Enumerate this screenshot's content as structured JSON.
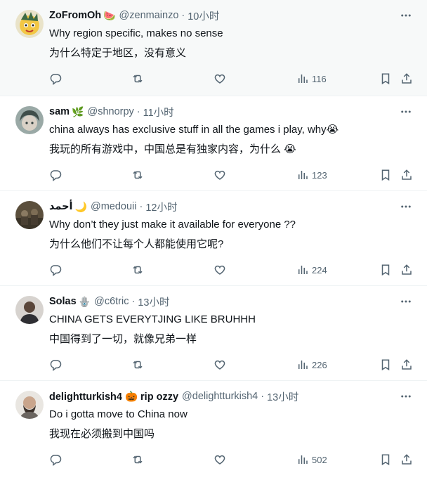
{
  "posts": [
    {
      "name": "ZoFromOh",
      "emoji": "🍉",
      "handle": "@zenmainzo",
      "time": "10小时",
      "text": "Why region specific, makes no sense",
      "translation": "为什么特定于地区，没有意义",
      "views": "116",
      "avatar_color": "#f2c744"
    },
    {
      "name": "sam",
      "emoji": "🌿",
      "handle": "@shnorpy",
      "time": "11小时",
      "text": "china always has exclusive stuff in all the games i play, why😭",
      "translation": "我玩的所有游戏中，中国总是有独家内容，为什么 😭",
      "views": "123",
      "avatar_color": "#7f9a9c"
    },
    {
      "name": "أحمد",
      "emoji": "🌙",
      "handle": "@medouii",
      "time": "12小时",
      "text": "Why don’t they just make it available for everyone ??",
      "translation": "为什么他们不让每个人都能使用它呢?",
      "views": "224",
      "avatar_color": "#5b4f3c"
    },
    {
      "name": "Solas",
      "emoji": "🪬",
      "handle": "@c6tric",
      "time": "13小时",
      "text": "CHINA GETS EVERYTJING LIKE BRUHHH",
      "translation": "中国得到了一切，就像兄弟一样",
      "views": "226",
      "avatar_color": "#6d6a66"
    },
    {
      "name": "delightturkish4 🎃 rip ozzy",
      "emoji": "",
      "handle": "@delightturkish4",
      "time": "13小时",
      "text": "Do i gotta move to China now",
      "translation": "我现在必须搬到中国吗",
      "views": "502",
      "avatar_color": "#c9c2b8"
    }
  ],
  "icons": {
    "reply": "reply-icon",
    "retweet": "retweet-icon",
    "like": "heart-icon",
    "views": "views-icon",
    "bookmark": "bookmark-icon",
    "share": "share-icon",
    "more": "more-icon"
  },
  "colors": {
    "text": "#0f1419",
    "muted": "#536471",
    "highlight_bg": "#f7f9f9",
    "divider": "#eff3f4"
  }
}
